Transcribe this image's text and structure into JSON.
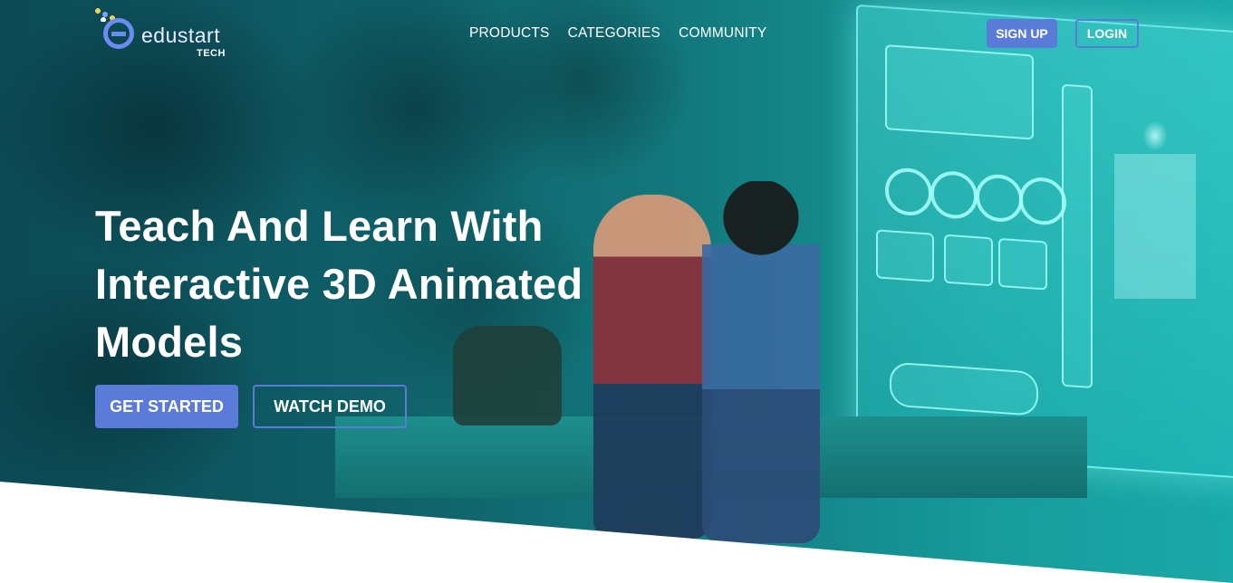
{
  "brand": {
    "name": "edustart",
    "sub": "TECH",
    "accent_color": "#5b7bd9"
  },
  "nav": {
    "items": [
      {
        "label": "PRODUCTS"
      },
      {
        "label": "CATEGORIES"
      },
      {
        "label": "COMMUNITY"
      }
    ]
  },
  "auth": {
    "signup_label": "SIGN UP",
    "login_label": "LOGIN"
  },
  "hero": {
    "headline_lines": [
      "Teach And Learn With",
      "Interactive 3D Animated",
      "Models"
    ],
    "primary_cta": "GET STARTED",
    "secondary_cta": "WATCH DEMO"
  },
  "icons": [
    "logo-e-icon"
  ]
}
